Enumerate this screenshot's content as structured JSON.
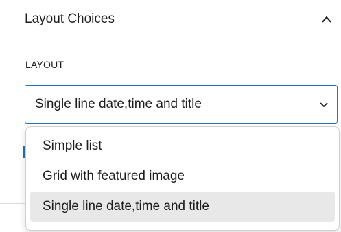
{
  "panel": {
    "title": "Layout Choices",
    "expanded": true,
    "toggle_icon": "chevron-up-icon"
  },
  "layout_field": {
    "label": "LAYOUT",
    "selected_value": "Single line date,time and title",
    "dropdown_icon": "chevron-down-icon",
    "options": [
      {
        "label": "Simple list",
        "selected": false
      },
      {
        "label": "Grid with featured image",
        "selected": false
      },
      {
        "label": "Single line date,time and title",
        "selected": true
      }
    ]
  },
  "colors": {
    "accent": "#2271b1",
    "text": "#1e1e1e",
    "selected_option_bg": "#e8e8e8",
    "border": "#d0d0d0"
  }
}
